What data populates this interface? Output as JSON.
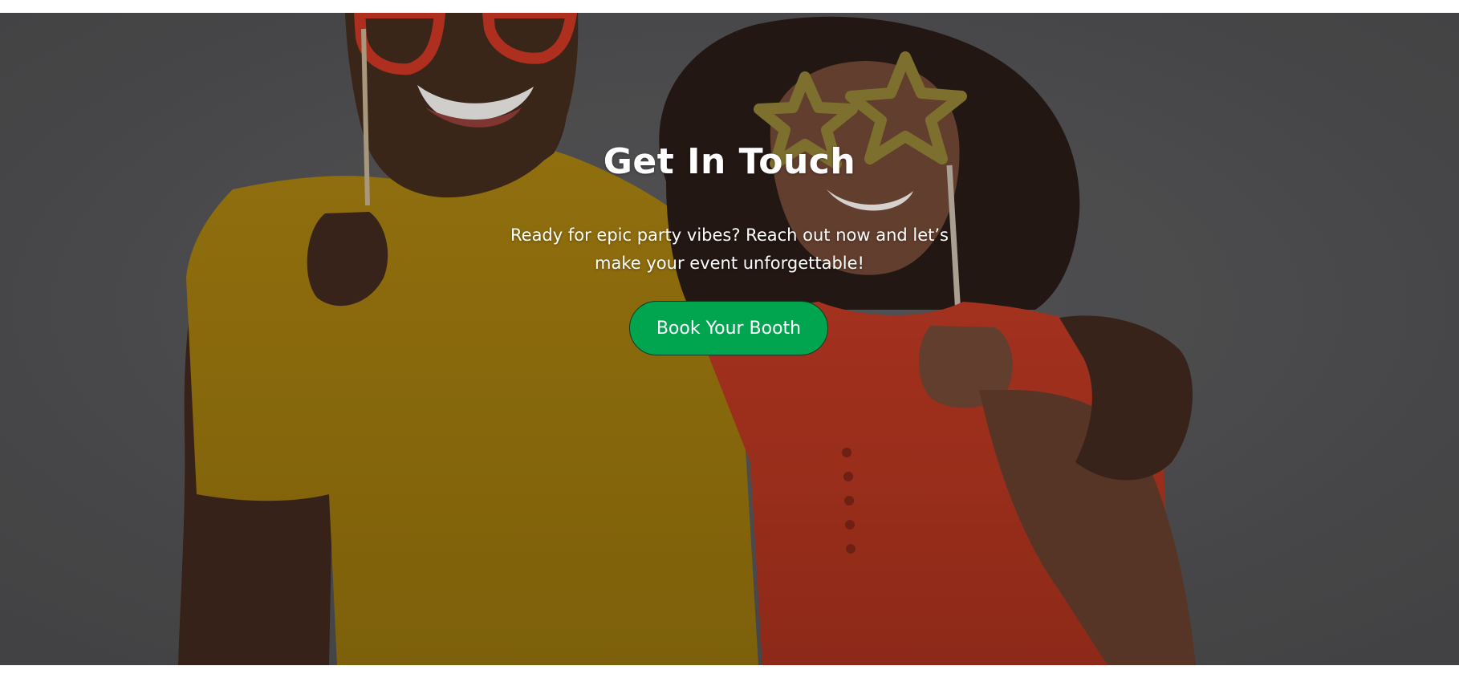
{
  "hero": {
    "title": "Get In Touch",
    "subtitle": "Ready for epic party vibes? Reach out now and let’s make your event unforgettable!",
    "cta_label": "Book Your Booth",
    "photo_subject": "smiling couple holding photo booth props",
    "colors": {
      "overlay": "#4d4d4f",
      "button": "#01a550",
      "button_border": "#0b3b23",
      "text": "#ffffff",
      "page_background": "#ffffff"
    }
  }
}
